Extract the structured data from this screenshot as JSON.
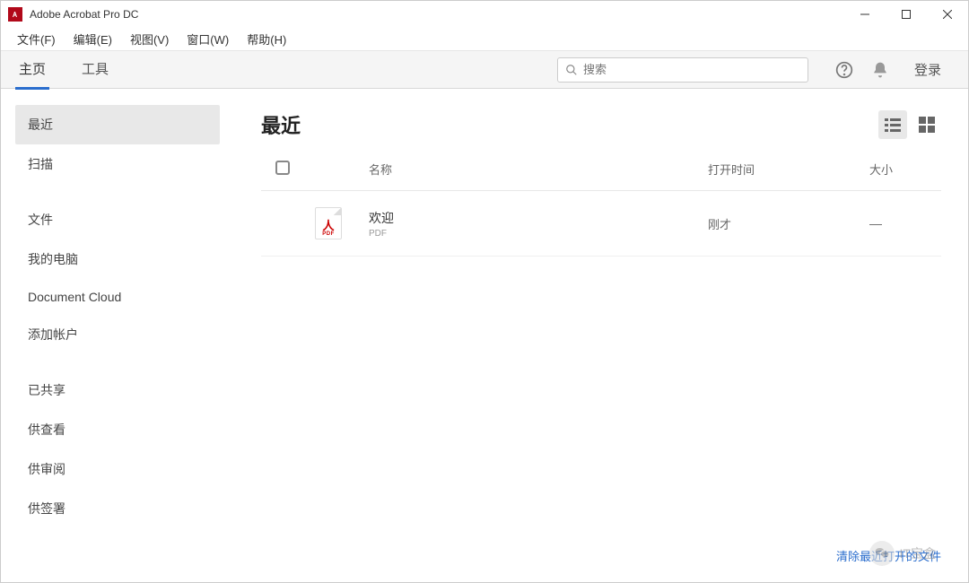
{
  "window": {
    "title": "Adobe Acrobat Pro DC"
  },
  "menubar": {
    "items": [
      "文件(F)",
      "编辑(E)",
      "视图(V)",
      "窗口(W)",
      "帮助(H)"
    ]
  },
  "toolbar": {
    "tabs": {
      "home": "主页",
      "tools": "工具"
    },
    "search_placeholder": "搜索",
    "login": "登录"
  },
  "sidebar": {
    "group1": [
      "最近",
      "扫描"
    ],
    "group2": [
      "文件",
      "我的电脑",
      "Document Cloud",
      "添加帐户"
    ],
    "group3": [
      "已共享",
      "供查看",
      "供审阅",
      "供签署"
    ]
  },
  "main": {
    "title": "最近",
    "columns": {
      "name": "名称",
      "opened": "打开时间",
      "size": "大小"
    },
    "rows": [
      {
        "name": "欢迎",
        "type": "PDF",
        "time": "刚才",
        "size": "—"
      }
    ],
    "clear_link": "清除最近打开的文件"
  },
  "watermark": "IT宝盒"
}
